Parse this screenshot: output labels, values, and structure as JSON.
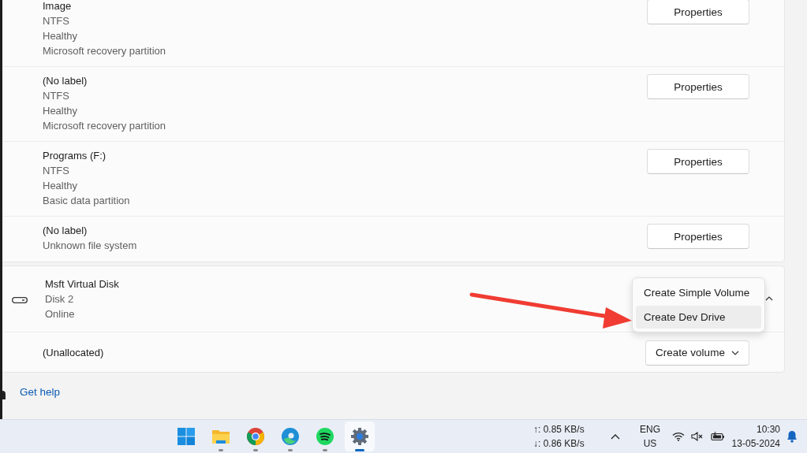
{
  "partitions": [
    {
      "name": "Image",
      "details": [
        "NTFS",
        "Healthy",
        "Microsoft recovery partition"
      ],
      "button": "Properties"
    },
    {
      "name": "(No label)",
      "details": [
        "NTFS",
        "Healthy",
        "Microsoft recovery partition"
      ],
      "button": "Properties"
    },
    {
      "name": "Programs (F:)",
      "details": [
        "NTFS",
        "Healthy",
        "Basic data partition"
      ],
      "button": "Properties"
    },
    {
      "name": "(No label)",
      "details": [
        "Unknown file system"
      ],
      "button": "Properties"
    }
  ],
  "disk": {
    "name": "Msft Virtual Disk",
    "details": [
      "Disk 2",
      "Online"
    ],
    "expanded": true
  },
  "unallocated": {
    "label": "(Unallocated)",
    "button": "Create volume"
  },
  "menu": {
    "items": [
      {
        "label": "Create Simple Volume",
        "highlighted": false
      },
      {
        "label": "Create Dev Drive",
        "highlighted": true
      }
    ]
  },
  "get_help": "Get help",
  "taskbar": {
    "apps": [
      {
        "kind": "start",
        "selected": false
      },
      {
        "kind": "explorer",
        "selected": false
      },
      {
        "kind": "chrome",
        "selected": false
      },
      {
        "kind": "edge",
        "selected": false
      },
      {
        "kind": "spotify",
        "selected": false
      },
      {
        "kind": "settings",
        "selected": true
      }
    ],
    "upload": "↑: 0.85 KB/s",
    "download": "↓: 0.86 KB/s",
    "language": "ENG",
    "region": "US",
    "time": "10:30",
    "date": "13-05-2024"
  }
}
